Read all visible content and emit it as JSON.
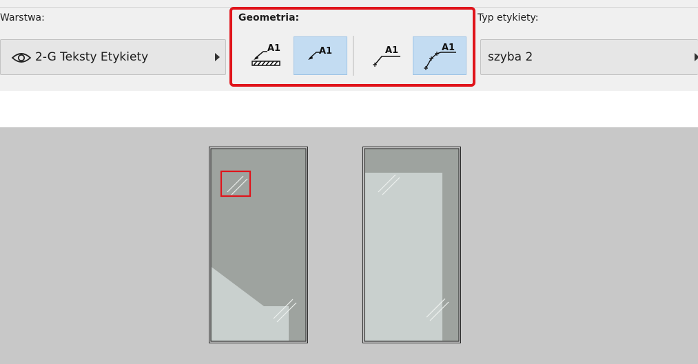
{
  "layer": {
    "label": "Warstwa:",
    "value": "2-G Teksty Etykiety",
    "icon": "eye-icon"
  },
  "geometry": {
    "label": "Geometria:",
    "buttons": [
      {
        "name": "anchor-hatched-label",
        "text": "A1",
        "active": false
      },
      {
        "name": "anchor-simple-label",
        "text": "A1",
        "active": true
      },
      {
        "name": "leader-line-label",
        "text": "A1",
        "active": false
      },
      {
        "name": "leader-multi-label",
        "text": "A1",
        "active": true
      }
    ],
    "highlight_color": "#e0141b"
  },
  "label_type": {
    "label": "Typ etykiety:",
    "value": "szyba 2"
  },
  "colors": {
    "toolbar_bg": "#f0f0f0",
    "active_button": "#c3dcf2",
    "canvas_bg": "#c8c8c8",
    "glass_dark": "#9ea39f",
    "glass_light": "#c9d0ce"
  }
}
